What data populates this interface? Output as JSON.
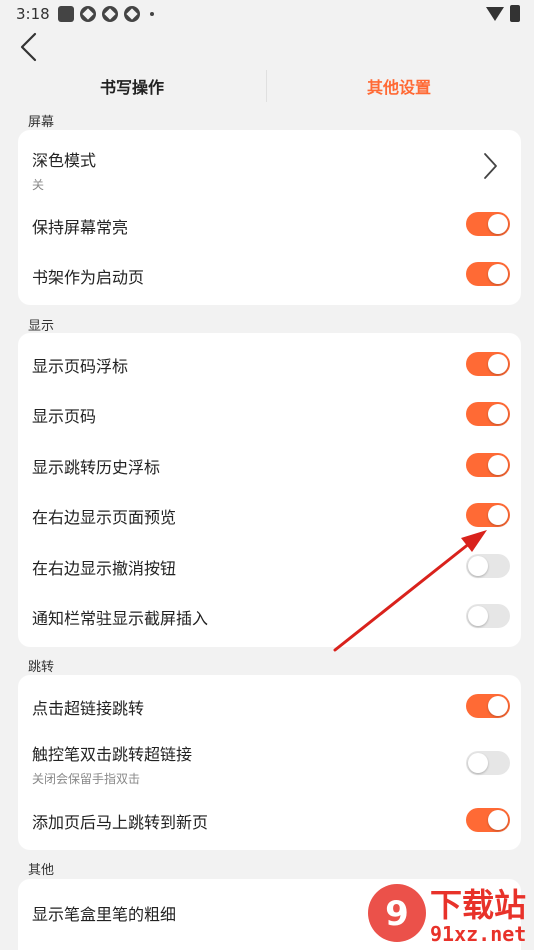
{
  "status_bar": {
    "time": "3:18"
  },
  "tabs": {
    "write_ops": "书写操作",
    "other_settings": "其他设置",
    "active": "other_settings"
  },
  "sections": {
    "screen": {
      "label": "屏幕",
      "dark_mode": {
        "label": "深色模式",
        "value": "关"
      },
      "keep_screen_on": {
        "label": "保持屏幕常亮",
        "on": true
      },
      "bookshelf_start": {
        "label": "书架作为启动页",
        "on": true
      }
    },
    "display": {
      "label": "显示",
      "items": [
        {
          "label": "显示页码浮标",
          "on": true
        },
        {
          "label": "显示页码",
          "on": true
        },
        {
          "label": "显示跳转历史浮标",
          "on": true
        },
        {
          "label": "在右边显示页面预览",
          "on": true
        },
        {
          "label": "在右边显示撤消按钮",
          "on": false
        },
        {
          "label": "通知栏常驻显示截屏插入",
          "on": false
        }
      ]
    },
    "jump": {
      "label": "跳转",
      "items": [
        {
          "label": "点击超链接跳转",
          "on": true
        },
        {
          "label": "触控笔双击跳转超链接",
          "sub": "关闭会保留手指双击",
          "on": false
        },
        {
          "label": "添加页后马上跳转到新页",
          "on": true
        }
      ]
    },
    "other": {
      "label": "其他",
      "items": [
        {
          "label": "显示笔盒里笔的粗细"
        }
      ]
    }
  },
  "watermark": {
    "title": "下载站",
    "url": "91xz.net"
  },
  "colors": {
    "accent": "#ff6a35",
    "toggle_off": "#e6e6e6",
    "annotation_arrow": "#d9221c",
    "watermark": "#e8322a"
  }
}
